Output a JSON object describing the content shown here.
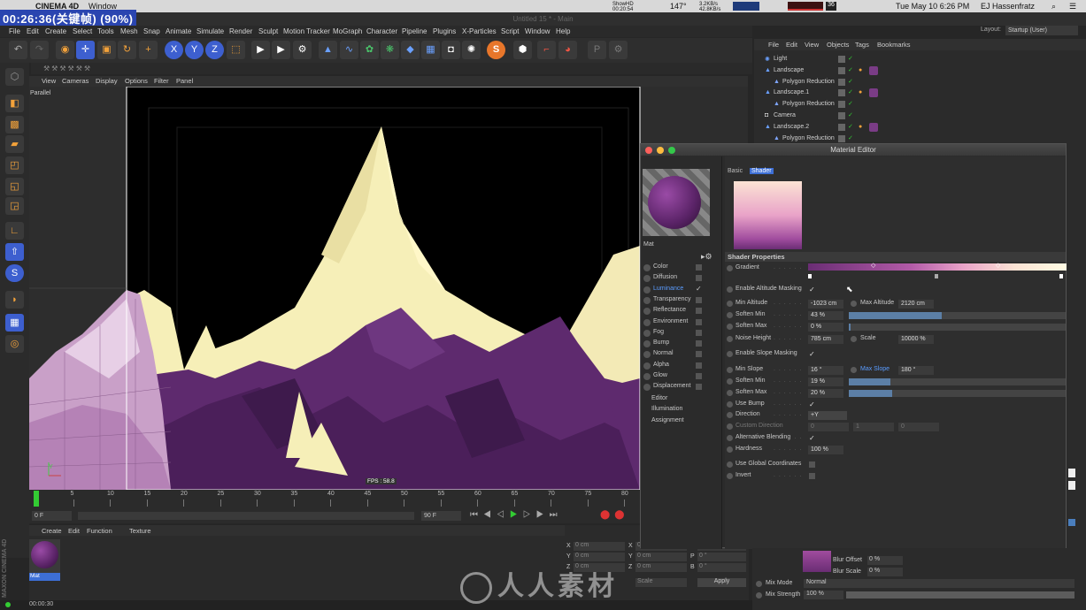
{
  "mac_menubar": {
    "app": "CINEMA 4D",
    "window_menu": "Window",
    "date_time": "Tue May 10  6:26 PM",
    "user": "EJ Hassenfratz",
    "network_up": "3.2KB/s",
    "network_down": "42.8KB/s",
    "temp": "147°",
    "showhd": "ShowHD",
    "showhd_time": "00:20:54",
    "other_value": "36"
  },
  "recording_overlay": "00:26:36(关键帧) (90%)",
  "window_title": "Untitled 15 * - Main",
  "layout": {
    "label": "Layout:",
    "value": "Startup (User)"
  },
  "c4d_menu": [
    "File",
    "Edit",
    "Create",
    "Select",
    "Tools",
    "Mesh",
    "Snap",
    "Animate",
    "Simulate",
    "Render",
    "Sculpt",
    "Motion Tracker",
    "MoGraph",
    "Character",
    "Pipeline",
    "Plugins",
    "X-Particles",
    "Script",
    "Window",
    "Help"
  ],
  "toolbar": {
    "axis_x": "X",
    "axis_y": "Y",
    "axis_z": "Z"
  },
  "viewport": {
    "menu": [
      "View",
      "Cameras",
      "Display",
      "Options",
      "Filter",
      "Panel"
    ],
    "projection": "Parallel",
    "fps": "FPS : 58.8"
  },
  "timeline": {
    "ticks": [
      "0",
      "5",
      "10",
      "15",
      "20",
      "25",
      "30",
      "35",
      "40",
      "45",
      "50",
      "55",
      "60",
      "65",
      "70",
      "75",
      "80"
    ],
    "start_frame": "0 F",
    "end_frame": "90 F"
  },
  "material_manager": {
    "menu": [
      "Create",
      "Edit",
      "Function",
      "Texture"
    ],
    "material_name": "Mat"
  },
  "coordinates": {
    "rows": [
      {
        "axis": "X",
        "pos": "0 cm",
        "axis2": "X",
        "size": "0 cm",
        "rot_label": "H",
        "rot": "0 °"
      },
      {
        "axis": "Y",
        "pos": "0 cm",
        "axis2": "Y",
        "size": "0 cm",
        "rot_label": "P",
        "rot": "0 °"
      },
      {
        "axis": "Z",
        "pos": "0 cm",
        "axis2": "Z",
        "size": "0 cm",
        "rot_label": "B",
        "rot": "0 °"
      }
    ],
    "mode": "Scale",
    "apply": "Apply"
  },
  "status_time": "00:00:30",
  "object_manager": {
    "menu": [
      "File",
      "Edit",
      "View",
      "Objects",
      "Tags",
      "Bookmarks"
    ],
    "objects": [
      {
        "name": "Light",
        "indent": 0
      },
      {
        "name": "Landscape",
        "indent": 0
      },
      {
        "name": "Polygon Reduction",
        "indent": 1
      },
      {
        "name": "Landscape.1",
        "indent": 0
      },
      {
        "name": "Polygon Reduction",
        "indent": 1
      },
      {
        "name": "Camera",
        "indent": 0
      },
      {
        "name": "Landscape.2",
        "indent": 0
      },
      {
        "name": "Polygon Reduction",
        "indent": 1
      }
    ]
  },
  "material_editor": {
    "title": "Material Editor",
    "material_name": "Mat",
    "tabs": [
      "Basic",
      "Shader"
    ],
    "section": "Shader Properties",
    "channels": [
      {
        "name": "Color",
        "checked": false,
        "active": false
      },
      {
        "name": "Diffusion",
        "checked": false,
        "active": false
      },
      {
        "name": "Luminance",
        "checked": true,
        "active": true
      },
      {
        "name": "Transparency",
        "checked": false,
        "active": false
      },
      {
        "name": "Reflectance",
        "checked": false,
        "active": false
      },
      {
        "name": "Environment",
        "checked": false,
        "active": false
      },
      {
        "name": "Fog",
        "checked": false,
        "active": false
      },
      {
        "name": "Bump",
        "checked": false,
        "active": false
      },
      {
        "name": "Normal",
        "checked": false,
        "active": false
      },
      {
        "name": "Alpha",
        "checked": false,
        "active": false
      },
      {
        "name": "Glow",
        "checked": false,
        "active": false
      },
      {
        "name": "Displacement",
        "checked": false,
        "active": false
      }
    ],
    "extra_items": [
      "Editor",
      "Illumination",
      "Assignment"
    ],
    "properties": {
      "gradient": "Gradient",
      "enable_altitude_masking": "Enable Altitude Masking",
      "min_altitude": {
        "label": "Min Altitude",
        "value": "-1023 cm"
      },
      "max_altitude": {
        "label": "Max Altitude",
        "value": "2120 cm"
      },
      "soften_min_alt": {
        "label": "Soften Min",
        "value": "43 %",
        "level": 0.43
      },
      "soften_max_alt": {
        "label": "Soften Max",
        "value": "0 %",
        "level": 0.0
      },
      "noise_height": {
        "label": "Noise Height",
        "value": "785 cm"
      },
      "scale": {
        "label": "Scale",
        "value": "10000 %"
      },
      "enable_slope_masking": "Enable Slope Masking",
      "min_slope": {
        "label": "Min Slope",
        "value": "16 °"
      },
      "max_slope": {
        "label": "Max Slope",
        "value": "180 °"
      },
      "soften_min_slope": {
        "label": "Soften Min",
        "value": "19 %",
        "level": 0.19
      },
      "soften_max_slope": {
        "label": "Soften Max",
        "value": "20 %",
        "level": 0.2
      },
      "use_bump": "Use Bump",
      "direction": {
        "label": "Direction",
        "value": "+Y"
      },
      "custom_direction": {
        "label": "Custom Direction",
        "values": [
          "0",
          "1",
          "0"
        ]
      },
      "alternative_blending": "Alternative Blending",
      "hardness": {
        "label": "Hardness",
        "value": "100 %"
      },
      "use_global_coordinates": "Use Global Coordinates",
      "invert": "Invert"
    }
  },
  "layer_panel": {
    "blur_offset": {
      "label": "Blur Offset",
      "value": "0 %"
    },
    "blur_scale": {
      "label": "Blur Scale",
      "value": "0 %"
    },
    "mix_mode": {
      "label": "Mix Mode",
      "value": "Normal"
    },
    "mix_strength": {
      "label": "Mix Strength",
      "value": "100 %"
    }
  },
  "watermark": "人人素材",
  "brand_side": "MAXON CINEMA 4D",
  "colors": {
    "accent_blue": "#3d5fcf",
    "purple": "#5e2a6e",
    "cream": "#f6efb8",
    "pink": "#d98ccf"
  }
}
